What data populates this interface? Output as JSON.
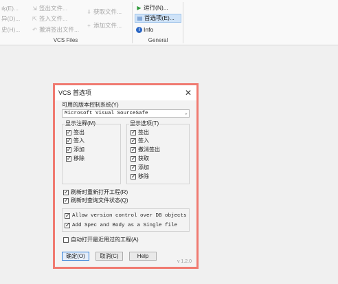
{
  "ribbon": {
    "vcs_group": {
      "label": "VCS Files",
      "col1": [
        "ıķ(E)...",
        "异(D)...",
        "史(H)..."
      ],
      "col2": [
        "签出文件...",
        "签入文件...",
        "撤消签出文件..."
      ],
      "col3": [
        "获取文件...",
        "添加文件..."
      ]
    },
    "general_group": {
      "label": "General",
      "run": "运行(N)...",
      "preferences": "首选项(E)...",
      "info": "Info"
    }
  },
  "dialog": {
    "title": "VCS 首选项",
    "vcs_label": "可用的版本控制系统(Y)",
    "vcs_selected": "Microsoft Visual SourceSafe",
    "comment_group": {
      "title": "显示注释(M)",
      "items": [
        "签出",
        "签入",
        "添加",
        "移除"
      ]
    },
    "option_group": {
      "title": "显示选项(T)",
      "items": [
        "签出",
        "签入",
        "撤消签出",
        "获取",
        "添加",
        "移除"
      ]
    },
    "refresh_reopen": "刷新时重新打开工程(R)",
    "refresh_status": "刷新时查询文件状态(Q)",
    "allow_vc": "Allow version control over DB objects",
    "add_spec": "Add Spec and Body as a Single file",
    "auto_open": "自动打开最近用过的工程(A)",
    "ok": "确定(O)",
    "cancel": "取消(C)",
    "help": "Help",
    "version": "v 1.2.0",
    "check_mark": "✓"
  }
}
